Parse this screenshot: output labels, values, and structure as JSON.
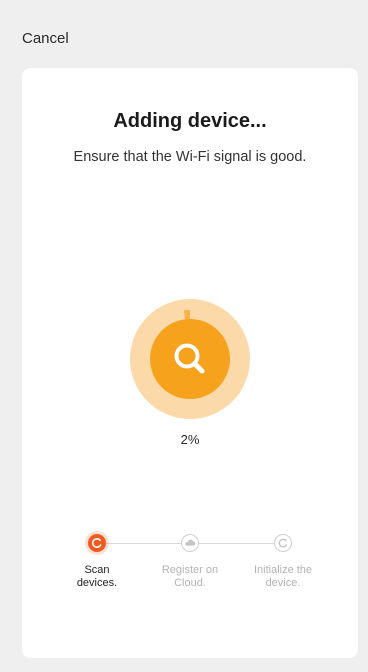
{
  "header": {
    "cancel_label": "Cancel"
  },
  "card": {
    "title": "Adding device...",
    "subtitle": "Ensure that the Wi-Fi signal is good."
  },
  "progress": {
    "value": 0.02,
    "label": "2%",
    "icon": "search-icon"
  },
  "steps": [
    {
      "label_line1": "Scan",
      "label_line2": "devices.",
      "state": "active",
      "icon": "refresh-icon"
    },
    {
      "label_line1": "Register on",
      "label_line2": "Cloud.",
      "state": "pending",
      "icon": "cloud-icon"
    },
    {
      "label_line1": "Initialize the",
      "label_line2": "device.",
      "state": "pending",
      "icon": "refresh-icon"
    }
  ],
  "colors": {
    "accent": "#f15a1e",
    "ring_outer": "#fcd9a8",
    "ring_mid": "#f9b04d",
    "ring_inner": "#f7a21d"
  }
}
